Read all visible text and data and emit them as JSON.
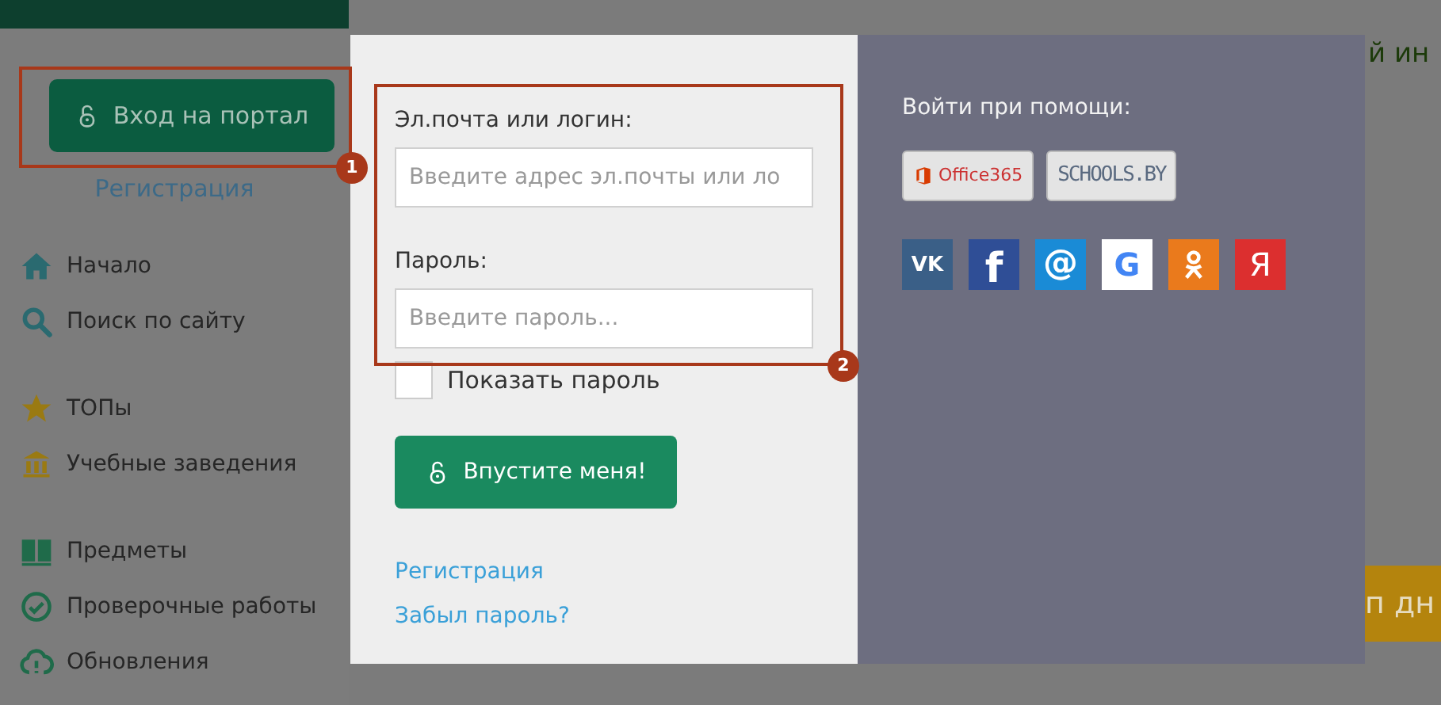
{
  "sidebar": {
    "login_button": "Вход на портал",
    "register_link": "Регистрация",
    "nav_groups": [
      [
        {
          "label": "Начало"
        },
        {
          "label": "Поиск по сайту"
        }
      ],
      [
        {
          "label": "ТОПы"
        },
        {
          "label": "Учебные заведения"
        }
      ],
      [
        {
          "label": "Предметы"
        },
        {
          "label": "Проверочные работы"
        },
        {
          "label": "Обновления"
        }
      ]
    ]
  },
  "page_fragments": {
    "heading": "й ин",
    "button": "п дн"
  },
  "login_popup": {
    "email_label": "Эл.почта или логин:",
    "email_placeholder": "Введите адрес эл.почты или ло",
    "password_label": "Пароль:",
    "password_placeholder": "Введите пароль...",
    "show_password": {
      "label": "Показать пароль",
      "checked": false
    },
    "submit_button": "Впустите меня!",
    "links": [
      "Регистрация",
      "Забыл пароль?"
    ],
    "social_title": "Войти при помощи:",
    "providers": [
      {
        "label": "Office365"
      },
      {
        "label": "SCHOOLS.BY"
      }
    ],
    "social": [
      {
        "kind": "vk",
        "glyph": "VK",
        "color": "#3a5f87"
      },
      {
        "kind": "facebook",
        "glyph": "f",
        "color": "#2f4e96"
      },
      {
        "kind": "mail",
        "glyph": "@",
        "color": "#1a8bd6"
      },
      {
        "kind": "google",
        "glyph": "G",
        "color": "#ffffff"
      },
      {
        "kind": "ok",
        "color": "#ea7a1c"
      },
      {
        "kind": "yandex",
        "glyph": "Я",
        "color": "#dc2f2f"
      }
    ]
  },
  "annotations": [
    {
      "number": "1"
    },
    {
      "number": "2"
    }
  ]
}
